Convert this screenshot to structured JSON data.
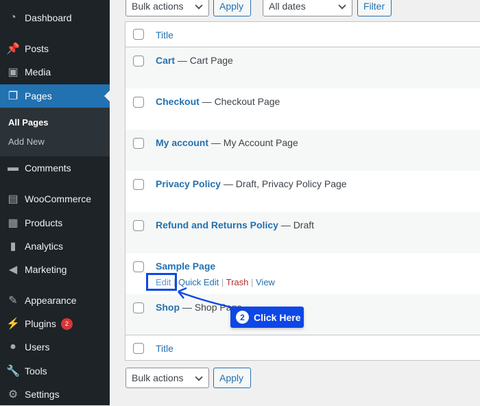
{
  "sidebar": {
    "items": [
      {
        "label": "Dashboard",
        "icon": "dashboard-icon",
        "glyph": "◔"
      },
      {
        "label": "Posts",
        "icon": "pin-icon",
        "glyph": "📌"
      },
      {
        "label": "Media",
        "icon": "media-icon",
        "glyph": "▣"
      },
      {
        "label": "Pages",
        "icon": "pages-icon",
        "glyph": "❐"
      },
      {
        "label": "Comments",
        "icon": "comment-icon",
        "glyph": "▬"
      },
      {
        "label": "WooCommerce",
        "icon": "woo-icon",
        "glyph": "▤"
      },
      {
        "label": "Products",
        "icon": "archive-icon",
        "glyph": "▦"
      },
      {
        "label": "Analytics",
        "icon": "bar-chart-icon",
        "glyph": "▮"
      },
      {
        "label": "Marketing",
        "icon": "megaphone-icon",
        "glyph": "◀"
      },
      {
        "label": "Appearance",
        "icon": "brush-icon",
        "glyph": "✎"
      },
      {
        "label": "Plugins",
        "icon": "plugin-icon",
        "glyph": "⚡",
        "badge": "2"
      },
      {
        "label": "Users",
        "icon": "user-icon",
        "glyph": "●"
      },
      {
        "label": "Tools",
        "icon": "wrench-icon",
        "glyph": "🔧"
      },
      {
        "label": "Settings",
        "icon": "settings-icon",
        "glyph": "⚙"
      }
    ],
    "submenu": [
      "All Pages",
      "Add New"
    ]
  },
  "toolbar": {
    "bulk": "Bulk actions",
    "apply": "Apply",
    "dates": "All dates",
    "filter": "Filter"
  },
  "table": {
    "column": "Title",
    "rows": [
      {
        "title": "Cart",
        "state": " — Cart Page"
      },
      {
        "title": "Checkout",
        "state": " — Checkout Page"
      },
      {
        "title": "My account",
        "state": " — My Account Page"
      },
      {
        "title": "Privacy Policy",
        "state": " — Draft, Privacy Policy Page"
      },
      {
        "title": "Refund and Returns Policy",
        "state": " — Draft"
      },
      {
        "title": "Sample Page",
        "state": ""
      },
      {
        "title": "Shop",
        "state": " — Shop Page"
      }
    ],
    "actions": {
      "edit": "Edit",
      "quick": "Quick Edit",
      "trash": "Trash",
      "view": "View",
      "sep": " | "
    }
  },
  "callout": {
    "step": "2",
    "text": "Click Here",
    "color": "#0d47e6"
  }
}
